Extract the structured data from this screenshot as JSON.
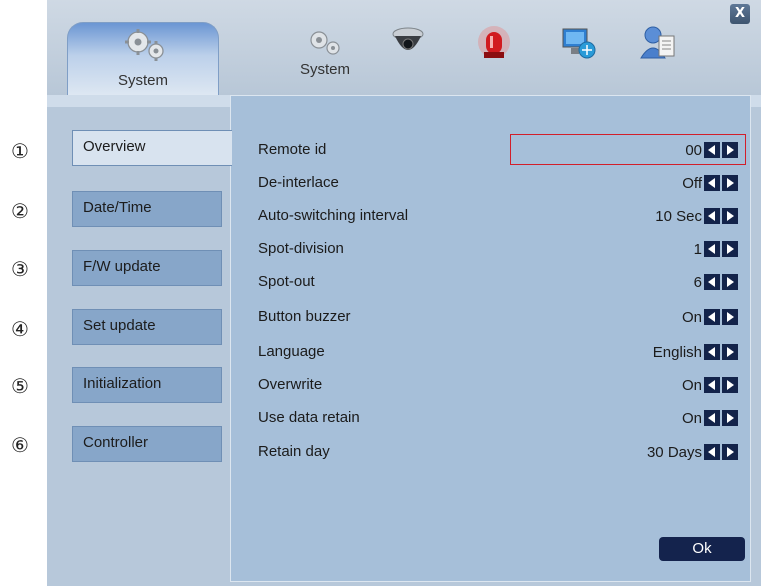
{
  "annotations": [
    "①",
    "②",
    "③",
    "④",
    "⑤",
    "⑥"
  ],
  "topbar": {
    "active_tab_label": "System",
    "tabs": [
      {
        "label": "System",
        "icon": "gears-icon"
      },
      {
        "label": "",
        "icon": "dome-camera-icon"
      },
      {
        "label": "",
        "icon": "alarm-siren-icon"
      },
      {
        "label": "",
        "icon": "network-monitor-icon"
      },
      {
        "label": "",
        "icon": "user-icon"
      }
    ],
    "close_label": "X"
  },
  "sidebar": {
    "items": [
      {
        "label": "Overview",
        "active": true
      },
      {
        "label": "Date/Time",
        "active": false
      },
      {
        "label": "F/W update",
        "active": false
      },
      {
        "label": "Set update",
        "active": false
      },
      {
        "label": "Initialization",
        "active": false
      },
      {
        "label": "Controller",
        "active": false
      }
    ]
  },
  "settings": [
    {
      "label": "Remote id",
      "value": "00"
    },
    {
      "label": "De-interlace",
      "value": "Off"
    },
    {
      "label": "Auto-switching interval",
      "value": "10 Sec"
    },
    {
      "label": "Spot-division",
      "value": "1"
    },
    {
      "label": "Spot-out",
      "value": "6"
    },
    {
      "label": "Button buzzer",
      "value": "On"
    },
    {
      "label": "Language",
      "value": "English"
    },
    {
      "label": "Overwrite",
      "value": "On"
    },
    {
      "label": "Use data retain",
      "value": "On"
    },
    {
      "label": "Retain day",
      "value": "30 Days"
    }
  ],
  "ok_label": "Ok",
  "colors": {
    "highlight": "#d21e2a",
    "arrow_button": "#13234a",
    "panel": "#a6bfd9"
  }
}
